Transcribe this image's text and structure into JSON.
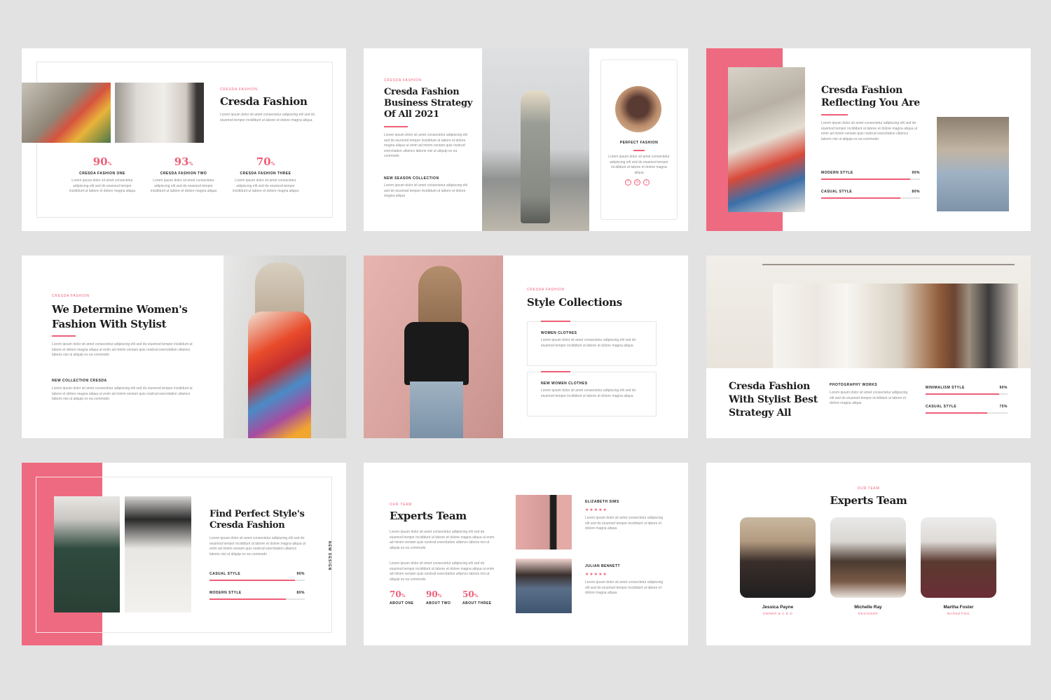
{
  "colors": {
    "accent": "#ee5f78",
    "background": "#e2e2e2",
    "slide": "#ffffff"
  },
  "lorem_short": "Lorem ipsum dolor sit amet consectetur adipiscing elit sed do eiusmod tempor incididunt ut labore et dolore magna aliqua",
  "lorem_long": "Lorem ipsum dolor sit amet consectetur adipiscing elit sed do eiusmod tempor incididunt ut labore et dolore magna aliqua ut enim ad minim veniam quis nostrud exercitation ullamco laboris nisi ut aliquip ex ea commodo",
  "slide1": {
    "tag": "Cresda Fashion",
    "title": "Cresda Fashion",
    "stats": [
      {
        "value": "90",
        "unit": "%",
        "label": "Cresda Fashion One"
      },
      {
        "value": "93",
        "unit": "%",
        "label": "Cresda Fashion Two"
      },
      {
        "value": "70",
        "unit": "%",
        "label": "Cresda Fashion Three"
      }
    ]
  },
  "slide2": {
    "tag": "Cresda Fashion",
    "title_lines": [
      "Cresda Fashion",
      "Business Strategy",
      "Of All 2021"
    ],
    "subhead": "New Season Collection",
    "profile_label": "Perfect Fashion",
    "social_icons": [
      "facebook-icon",
      "instagram-icon",
      "twitter-icon"
    ]
  },
  "slide3": {
    "title_lines": [
      "Cresda Fashion",
      "Reflecting You Are"
    ],
    "bars": [
      {
        "label": "Modern Style",
        "value": "90%",
        "fill": 0.9
      },
      {
        "label": "Casual Style",
        "value": "80%",
        "fill": 0.8
      }
    ]
  },
  "slide4": {
    "tag": "Cresda Fashion",
    "title_lines": [
      "We Determine Women's",
      "Fashion With Stylist"
    ],
    "subhead": "New Collection  Cresda"
  },
  "slide5": {
    "tag": "Cresda Fashion",
    "title": "Style Collections",
    "cards": [
      {
        "label": "Women Clothes"
      },
      {
        "label": "New Women Clothes"
      }
    ]
  },
  "slide6": {
    "title_lines": [
      "Cresda Fashion",
      "With Stylist Best",
      "Strategy All"
    ],
    "subhead": "Photography Works",
    "bars": [
      {
        "label": "Minimalism Style",
        "value": "90%",
        "fill": 0.9
      },
      {
        "label": "Casual Style",
        "value": "75%",
        "fill": 0.75
      }
    ]
  },
  "slide7": {
    "title_lines": [
      "Find Perfect Style's",
      "Cresda Fashion"
    ],
    "vertical_text": "New Design",
    "bars": [
      {
        "label": "Casual Style",
        "value": "90%",
        "fill": 0.9
      },
      {
        "label": "Modern Style",
        "value": "80%",
        "fill": 0.8
      }
    ]
  },
  "slide8": {
    "tag": "Our Team",
    "title": "Experts Team",
    "stats": [
      {
        "value": "70",
        "unit": "%",
        "label": "About One"
      },
      {
        "value": "90",
        "unit": "%",
        "label": "About Two"
      },
      {
        "value": "50",
        "unit": "%",
        "label": "About Three"
      }
    ],
    "members": [
      {
        "name": "Elizabeth Sims",
        "stars": "★★★★★"
      },
      {
        "name": "Julian Bennett",
        "stars": "★★★★★"
      }
    ]
  },
  "slide9": {
    "tag": "Our Team",
    "title": "Experts Team",
    "members": [
      {
        "name": "Jessica Payne",
        "role": "Owner & C.E.O"
      },
      {
        "name": "Michelle Ray",
        "role": "Designer"
      },
      {
        "name": "Martha Foster",
        "role": "Marketing"
      }
    ]
  }
}
